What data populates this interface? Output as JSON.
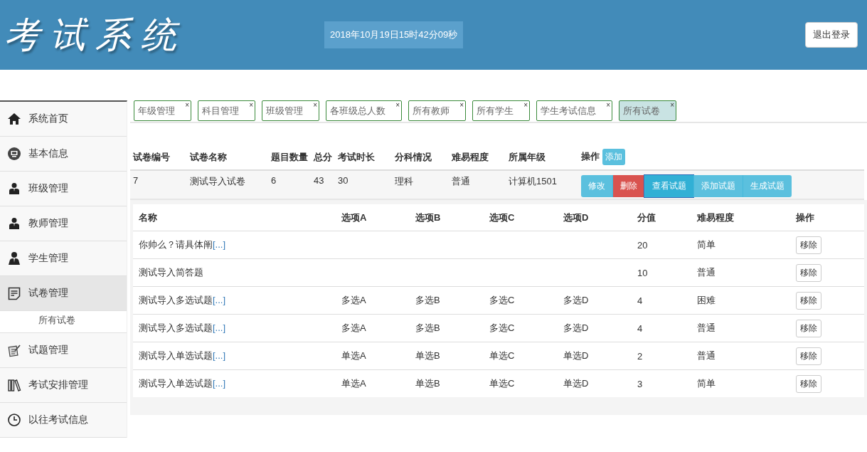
{
  "header": {
    "title": "考试系统",
    "datetime": "2018年10月19日15时42分09秒",
    "logout": "退出登录"
  },
  "sidebar": {
    "items": [
      {
        "label": "系统首页",
        "selected": false
      },
      {
        "label": "基本信息",
        "selected": false
      },
      {
        "label": "班级管理",
        "selected": false
      },
      {
        "label": "教师管理",
        "selected": false
      },
      {
        "label": "学生管理",
        "selected": false
      },
      {
        "label": "试卷管理",
        "selected": true,
        "expanded": true,
        "children": [
          {
            "label": "所有试卷"
          }
        ]
      },
      {
        "label": "试题管理",
        "selected": false
      },
      {
        "label": "考试安排管理",
        "selected": false
      },
      {
        "label": "以往考试信息",
        "selected": false
      }
    ]
  },
  "tabs": [
    {
      "label": "年级管理",
      "close": "×",
      "selected": false
    },
    {
      "label": "科目管理",
      "close": "×",
      "selected": false
    },
    {
      "label": "班级管理",
      "close": "×",
      "selected": false
    },
    {
      "label": "各班级总人数",
      "close": "×",
      "selected": false
    },
    {
      "label": "所有教师",
      "close": "×",
      "selected": false
    },
    {
      "label": "所有学生",
      "close": "×",
      "selected": false
    },
    {
      "label": "学生考试信息",
      "close": "×",
      "selected": false
    },
    {
      "label": "所有试卷",
      "close": "×",
      "selected": true
    }
  ],
  "papers": {
    "columns": [
      "试卷编号",
      "试卷名称",
      "题目数量",
      "总分",
      "考试时长",
      "分科情况",
      "难易程度",
      "所属年级",
      "操作"
    ],
    "add_button": "添加",
    "rows": [
      {
        "cells": [
          "7",
          "测试导入试卷",
          "6",
          "43",
          "30",
          "理科",
          "普通",
          "计算机1501"
        ],
        "actions": [
          {
            "label": "修改",
            "kind": "info"
          },
          {
            "label": "删除",
            "kind": "danger"
          },
          {
            "label": "查看试题",
            "kind": "primary"
          },
          {
            "label": "添加试题",
            "kind": "info"
          },
          {
            "label": "生成试题",
            "kind": "info"
          }
        ]
      }
    ]
  },
  "questions": {
    "columns": [
      "名称",
      "选项A",
      "选项B",
      "选项C",
      "选项D",
      "分值",
      "难易程度",
      "操作"
    ],
    "rows": [
      {
        "cells": [
          {
            "text": "你帅么？请具体阐",
            "more": "[...]"
          },
          "",
          "",
          "",
          "",
          "20",
          "简单",
          "移除"
        ]
      },
      {
        "cells": [
          {
            "text": "测试导入简答题"
          },
          "",
          "",
          "",
          "",
          "10",
          "普通",
          "移除"
        ]
      },
      {
        "cells": [
          {
            "text": "测试导入多选试题",
            "more": "[...]"
          },
          "多选A",
          "多选B",
          "多选C",
          "多选D",
          "4",
          "困难",
          "移除"
        ]
      },
      {
        "cells": [
          {
            "text": "测试导入多选试题",
            "more": "[...]"
          },
          "多选A",
          "多选B",
          "多选C",
          "多选D",
          "4",
          "普通",
          "移除"
        ]
      },
      {
        "cells": [
          {
            "text": "测试导入单选试题",
            "more": "[...]"
          },
          "单选A",
          "单选B",
          "单选C",
          "单选D",
          "2",
          "普通",
          "移除"
        ]
      },
      {
        "cells": [
          {
            "text": "测试导入单选试题",
            "more": "[...]"
          },
          "单选A",
          "单选B",
          "单选C",
          "单选D",
          "3",
          "简单",
          "移除"
        ]
      }
    ]
  }
}
